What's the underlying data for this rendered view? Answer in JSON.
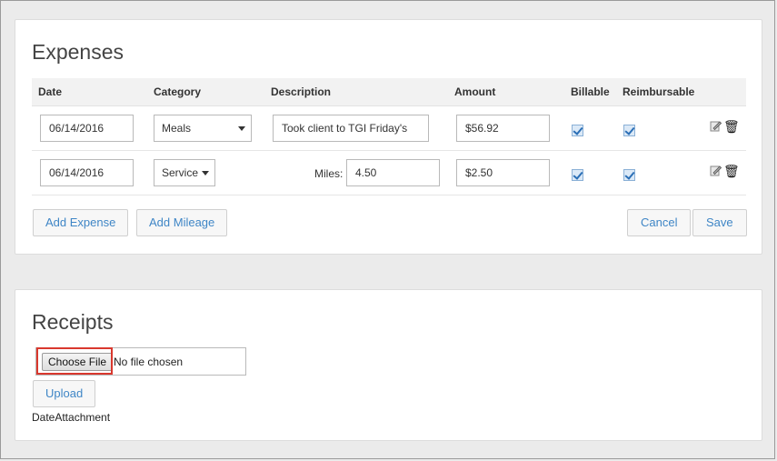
{
  "expenses": {
    "title": "Expenses",
    "columns": {
      "date": "Date",
      "category": "Category",
      "description": "Description",
      "amount": "Amount",
      "billable": "Billable",
      "reimbursable": "Reimbursable"
    },
    "rows": [
      {
        "date": "06/14/2016",
        "category": "Meals",
        "description": "Took client to TGI Friday's",
        "amount": "$56.92",
        "billable": true,
        "reimbursable": true
      },
      {
        "date": "06/14/2016",
        "category": "Service",
        "miles_label": "Miles:",
        "miles": "4.50",
        "amount": "$2.50",
        "billable": true,
        "reimbursable": true
      }
    ],
    "buttons": {
      "add_expense": "Add Expense",
      "add_mileage": "Add Mileage",
      "cancel": "Cancel",
      "save": "Save"
    }
  },
  "receipts": {
    "title": "Receipts",
    "choose_file": "Choose File",
    "no_file": "No file chosen",
    "upload": "Upload",
    "date_attachment": "DateAttachment"
  },
  "icons": {
    "edit": "edit-icon",
    "delete": "trash-icon"
  }
}
